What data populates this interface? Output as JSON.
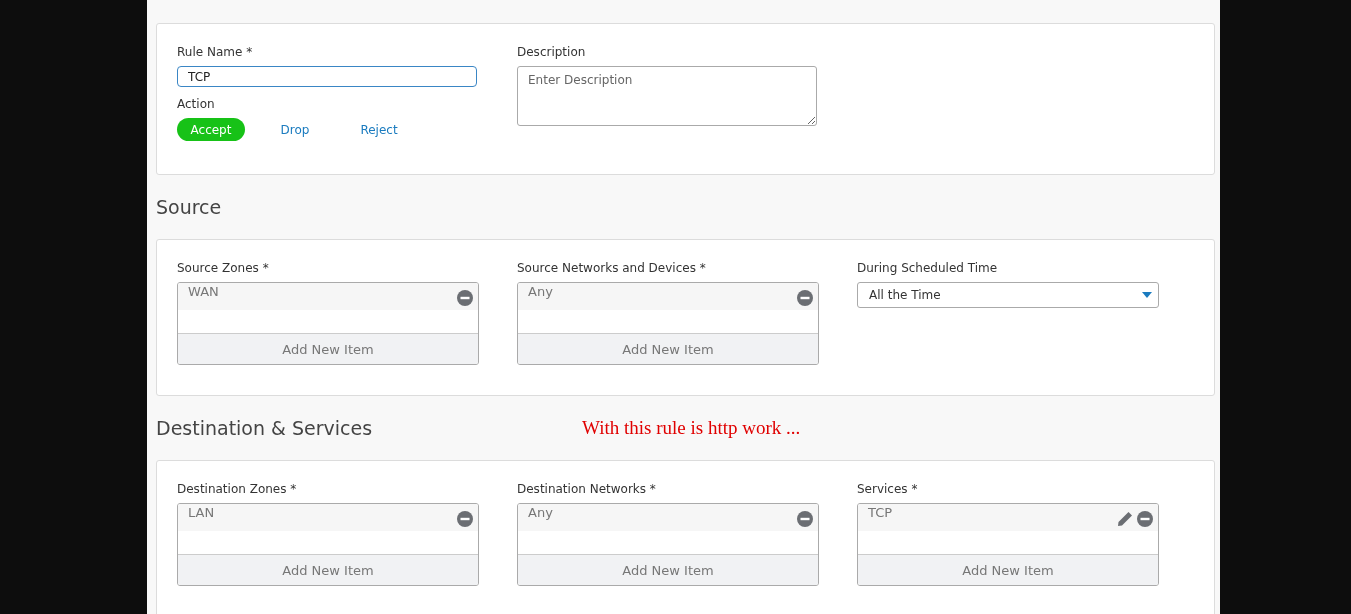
{
  "rule": {
    "name_label": "Rule Name *",
    "name_value": "TCP",
    "action_label": "Action",
    "actions": [
      {
        "label": "Accept",
        "selected": true
      },
      {
        "label": "Drop",
        "selected": false
      },
      {
        "label": "Reject",
        "selected": false
      }
    ],
    "description_label": "Description",
    "description_placeholder": "Enter Description"
  },
  "sections": [
    {
      "title": "Source",
      "fields": [
        {
          "kind": "list",
          "label": "Source Zones *",
          "items": [
            {
              "text": "WAN",
              "editable": false
            }
          ],
          "add_label": "Add New Item"
        },
        {
          "kind": "list",
          "label": "Source Networks and Devices *",
          "items": [
            {
              "text": "Any",
              "editable": false
            }
          ],
          "add_label": "Add New Item"
        },
        {
          "kind": "select",
          "label": "During Scheduled Time",
          "value": "All the Time"
        }
      ]
    },
    {
      "title": "Destination & Services",
      "annotation": "With this rule is http work ...",
      "fields": [
        {
          "kind": "list",
          "label": "Destination Zones *",
          "items": [
            {
              "text": "LAN",
              "editable": false
            }
          ],
          "add_label": "Add New Item"
        },
        {
          "kind": "list",
          "label": "Destination Networks *",
          "items": [
            {
              "text": "Any",
              "editable": false
            }
          ],
          "add_label": "Add New Item"
        },
        {
          "kind": "list",
          "label": "Services *",
          "items": [
            {
              "text": "TCP",
              "editable": true
            }
          ],
          "add_label": "Add New Item"
        }
      ]
    }
  ]
}
